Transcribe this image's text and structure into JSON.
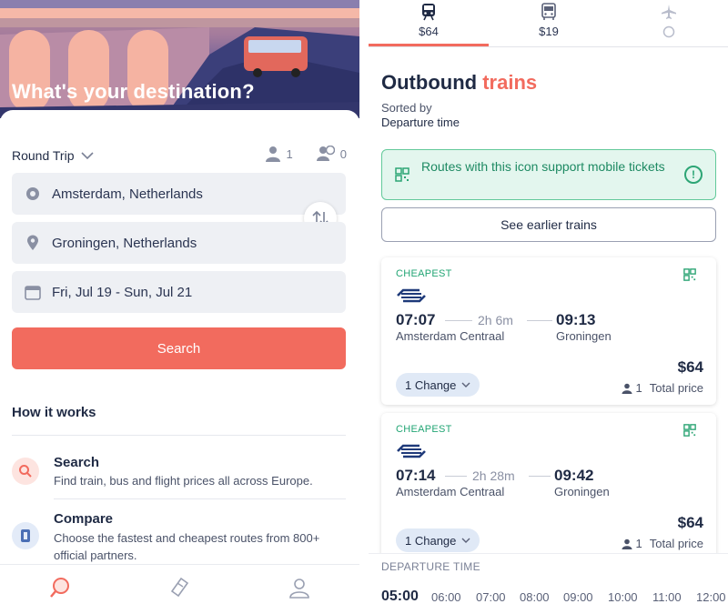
{
  "left": {
    "hero": {
      "title": "What's your destination?"
    },
    "trip_type": "Round Trip",
    "adults_count": "1",
    "cards_count": "0",
    "from": "Amsterdam, Netherlands",
    "to": "Groningen, Netherlands",
    "dates": "Fri, Jul 19 - Sun, Jul 21",
    "search_label": "Search",
    "how_title": "How it works",
    "how_items": [
      {
        "title": "Search",
        "desc": "Find train, bus and flight prices all across Europe."
      },
      {
        "title": "Compare",
        "desc": "Choose the fastest and cheapest routes from 800+ official partners."
      }
    ],
    "colors": {
      "accent": "#f26b5e",
      "field_bg": "#eef0f4"
    }
  },
  "right": {
    "tabs": [
      {
        "icon": "train-icon",
        "price": "$64"
      },
      {
        "icon": "bus-icon",
        "price": "$19"
      },
      {
        "icon": "plane-icon",
        "price": ""
      }
    ],
    "title_part1": "Outbound",
    "title_part2": "trains",
    "sorted_label": "Sorted by",
    "sorted_value": "Departure time",
    "mticket_text": "Routes with this icon support mobile tickets",
    "earlier_label": "See earlier trains",
    "results": [
      {
        "badge": "CHEAPEST",
        "dep_time": "07:07",
        "duration": "2h 6m",
        "arr_time": "09:13",
        "from": "Amsterdam Centraal",
        "to": "Groningen",
        "changes": "1 Change",
        "price": "$64",
        "pax": "1",
        "total_label": "Total price"
      },
      {
        "badge": "CHEAPEST",
        "dep_time": "07:14",
        "duration": "2h 28m",
        "arr_time": "09:42",
        "from": "Amsterdam Centraal",
        "to": "Groningen",
        "changes": "1 Change",
        "price": "$64",
        "pax": "1",
        "total_label": "Total price"
      }
    ],
    "timebar": {
      "label": "DEPARTURE TIME",
      "selected": "05:00",
      "slots": [
        "06:00",
        "07:00",
        "08:00",
        "09:00",
        "10:00",
        "11:00",
        "12:00"
      ]
    },
    "colors": {
      "accent": "#f26b5e",
      "mticket_green": "#1e8a63"
    }
  }
}
